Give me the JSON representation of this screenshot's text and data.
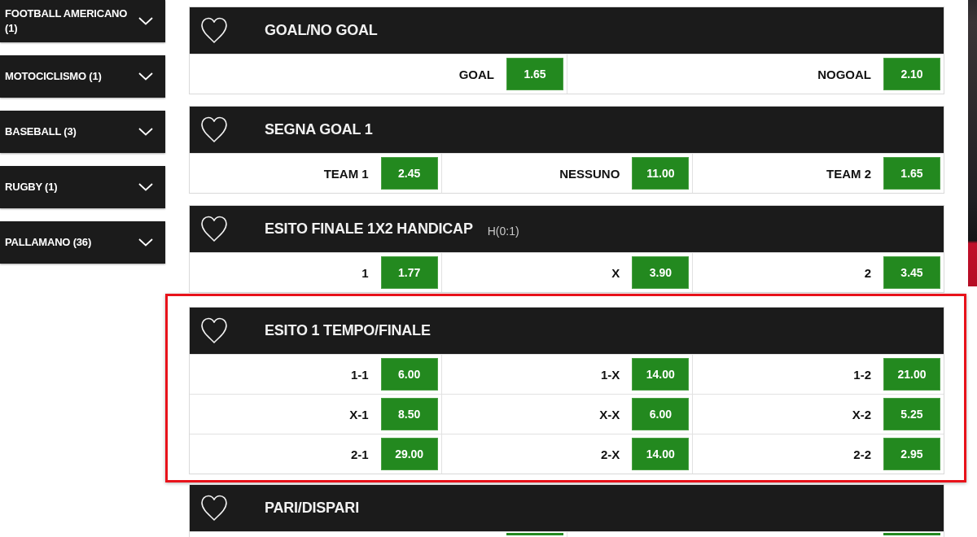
{
  "sidebar": {
    "items": [
      {
        "label": "FOOTBALL AMERICANO (1)",
        "expanded": false
      },
      {
        "label": "MOTOCICLISMO (1)",
        "expanded": false
      },
      {
        "label": "BASEBALL (3)",
        "expanded": false
      },
      {
        "label": "RUGBY (1)",
        "expanded": false
      },
      {
        "label": "PALLAMANO (36)",
        "expanded": false
      }
    ]
  },
  "markets": [
    {
      "title": "GOAL/NO GOAL",
      "favorite": false,
      "highlighted": false,
      "rows": [
        {
          "kind": "full",
          "outcomes": [
            {
              "kind": "odds",
              "label": "GOAL",
              "odds": "1.65"
            },
            {
              "kind": "odds",
              "label": "NOGOAL",
              "odds": "2.10"
            }
          ]
        }
      ]
    },
    {
      "title": "SEGNA GOAL 1",
      "favorite": false,
      "highlighted": false,
      "rows": [
        {
          "kind": "full",
          "outcomes": [
            {
              "kind": "odds",
              "label": "TEAM 1",
              "odds": "2.45"
            },
            {
              "kind": "odds",
              "label": "NESSUNO",
              "odds": "11.00"
            },
            {
              "kind": "odds",
              "label": "TEAM 2",
              "odds": "1.65"
            }
          ]
        }
      ]
    },
    {
      "title": "ESITO FINALE 1X2 HANDICAP",
      "subtitle": "H(0:1)",
      "favorite": false,
      "highlighted": false,
      "rows": [
        {
          "kind": "full",
          "outcomes": [
            {
              "kind": "odds",
              "label": "1",
              "odds": "1.77"
            },
            {
              "kind": "odds",
              "label": "X",
              "odds": "3.90"
            },
            {
              "kind": "odds",
              "label": "2",
              "odds": "3.45"
            }
          ]
        }
      ]
    },
    {
      "title": "ESITO 1 TEMPO/FINALE",
      "favorite": false,
      "highlighted": true,
      "rows": [
        {
          "kind": "full",
          "outcomes": [
            {
              "kind": "odds",
              "label": "1-1",
              "odds": "6.00"
            },
            {
              "kind": "odds",
              "label": "1-X",
              "odds": "14.00"
            },
            {
              "kind": "odds",
              "label": "1-2",
              "odds": "21.00"
            }
          ]
        },
        {
          "kind": "full",
          "outcomes": [
            {
              "kind": "odds",
              "label": "X-1",
              "odds": "8.50"
            },
            {
              "kind": "odds",
              "label": "X-X",
              "odds": "6.00"
            },
            {
              "kind": "odds",
              "label": "X-2",
              "odds": "5.25"
            }
          ]
        },
        {
          "kind": "full",
          "outcomes": [
            {
              "kind": "odds",
              "label": "2-1",
              "odds": "29.00"
            },
            {
              "kind": "odds",
              "label": "2-X",
              "odds": "14.00"
            },
            {
              "kind": "odds",
              "label": "2-2",
              "odds": "2.95"
            }
          ]
        }
      ]
    },
    {
      "title": "PARI/DISPARI",
      "favorite": false,
      "highlighted": false,
      "rows": [
        {
          "kind": "cut",
          "outcomes": [
            {
              "kind": "odds"
            },
            {
              "kind": "odds"
            }
          ]
        }
      ]
    }
  ]
}
